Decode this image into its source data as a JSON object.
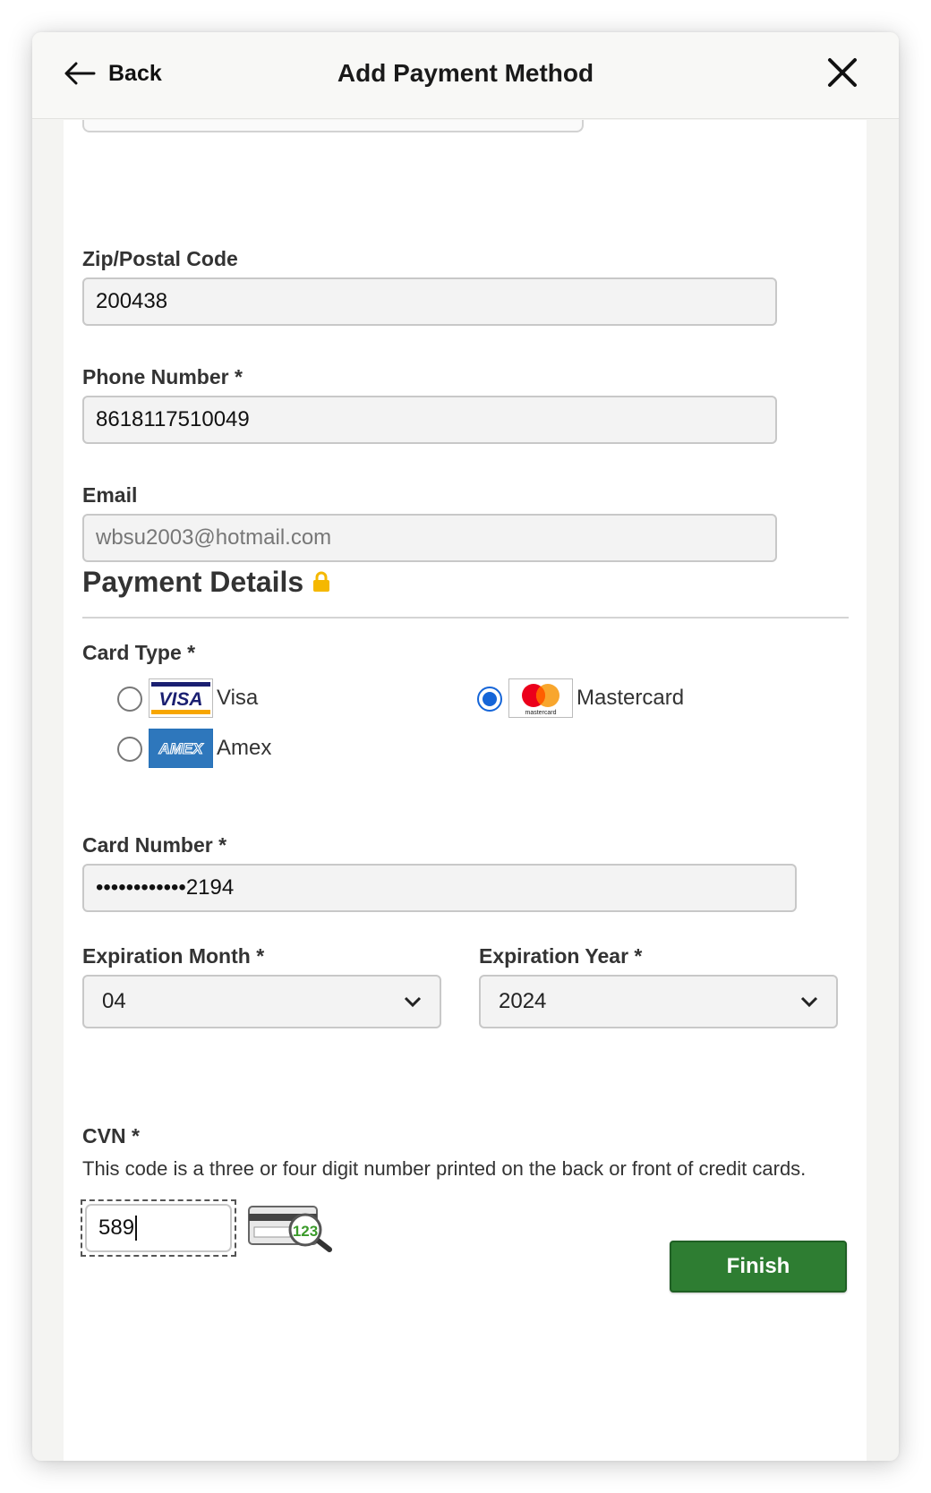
{
  "header": {
    "back_label": "Back",
    "title": "Add Payment Method",
    "close_icon": "close-icon"
  },
  "form": {
    "zip": {
      "label": "Zip/Postal Code",
      "value": "200438"
    },
    "phone": {
      "label": "Phone Number *",
      "value": "8618117510049"
    },
    "email": {
      "label": "Email",
      "value": "wbsu2003@hotmail.com"
    }
  },
  "payment": {
    "section_title": "Payment Details",
    "lock_icon": "lock-icon",
    "card_type_label": "Card Type *",
    "card_types": [
      {
        "label": "Visa",
        "logo_text": "VISA",
        "selected": false
      },
      {
        "label": "Mastercard",
        "logo_text": "mastercard",
        "selected": true
      },
      {
        "label": "Amex",
        "logo_text": "AMEX",
        "selected": false
      }
    ],
    "card_number": {
      "label": "Card Number *",
      "value": "••••••••••••2194"
    },
    "exp_month": {
      "label": "Expiration Month *",
      "value": "04"
    },
    "exp_year": {
      "label": "Expiration Year *",
      "value": "2024"
    },
    "cvn": {
      "label": "CVN *",
      "hint": "This code is a three or four digit number printed on the back or front of credit cards.",
      "value": "589",
      "illustration_text": "123"
    },
    "finish_label": "Finish"
  },
  "colors": {
    "accent_green": "#2e7d32",
    "radio_blue": "#1565d8",
    "lock_gold": "#f5b800"
  }
}
